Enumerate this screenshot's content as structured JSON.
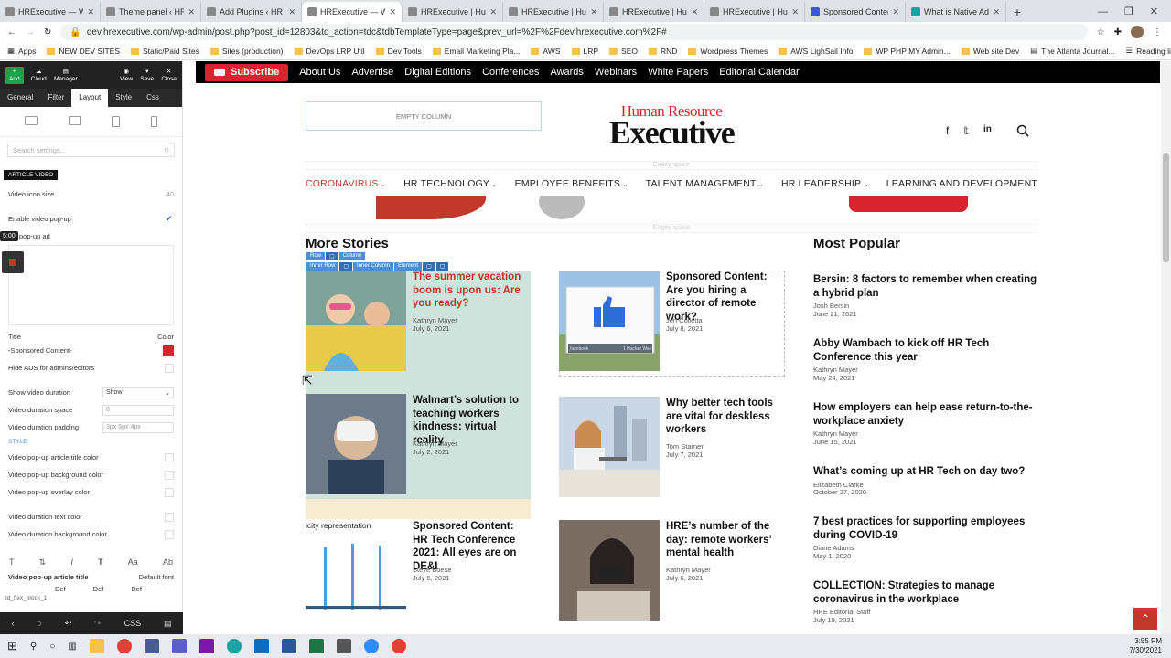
{
  "browser": {
    "tabs": [
      {
        "label": "HRExecutive — W",
        "active": false
      },
      {
        "label": "Theme panel ‹ HR",
        "active": false
      },
      {
        "label": "Add Plugins ‹ HR",
        "active": false
      },
      {
        "label": "HRExecutive — W",
        "active": true
      },
      {
        "label": "HRExecutive | Hum",
        "active": false
      },
      {
        "label": "HRExecutive | Hum",
        "active": false
      },
      {
        "label": "HRExecutive | Hum",
        "active": false
      },
      {
        "label": "HRExecutive | Hum",
        "active": false
      },
      {
        "label": "Sponsored Conten",
        "active": false
      },
      {
        "label": "What is Native Ad",
        "active": false
      }
    ],
    "url": "dev.hrexecutive.com/wp-admin/post.php?post_id=12803&td_action=tdc&tdbTemplateType=page&prev_url=%2F%2Fdev.hrexecutive.com%2F#",
    "bookmarks": [
      "Apps",
      "NEW DEV SITES",
      "Static/Paid Sites",
      "Sites (production)",
      "DevOps LRP Util",
      "Dev Tools",
      "Email Marketing Pla...",
      "AWS",
      "LRP",
      "SEO",
      "RND",
      "Wordpress Themes",
      "AWS LighSail Info",
      "WP PHP MY Admin...",
      "Web site Dev",
      "The Atlanta Journal...",
      "Reading list"
    ]
  },
  "editor": {
    "toolbar": [
      "Add",
      "Cloud",
      "Manager",
      "View",
      "Save",
      "Close"
    ],
    "tabs": [
      "General",
      "Filter",
      "Layout",
      "Style",
      "Css"
    ],
    "active_tab": "Layout",
    "search_placeholder": "Search settings...",
    "section": "ARTICLE VIDEO",
    "video_icon_size_label": "Video icon size",
    "video_icon_size_value": "40",
    "enable_popup_label": "Enable video pop-up",
    "popup_ad_label": "pop-up ad",
    "time_badge": "5:00",
    "title_label": "Title",
    "color_label": "Color",
    "title_value": "-Sponsored Content-",
    "hide_ads_label": "Hide ADS for admins/editors",
    "show_duration_label": "Show video duration",
    "show_duration_value": "Show",
    "duration_space_label": "Video duration space",
    "duration_space_value": "0",
    "duration_padding_label": "Video duration padding",
    "duration_padding_value": "3px 6px 4px",
    "style_header": "STYLE",
    "style_rows": [
      "Video pop-up article title color",
      "Video pop-up background color",
      "Video pop-up overlay color",
      "Video duration text color",
      "Video duration background color"
    ],
    "font_row_label": "Video pop-up article title",
    "font_row_value": "Default font",
    "def_values": [
      "Def",
      "Def",
      "Def"
    ],
    "flex_block_label": "td_flex_block_1",
    "bottom_css": "CSS"
  },
  "site": {
    "subscribe": "Subscribe",
    "top_links": [
      "About Us",
      "Advertise",
      "Digital Editions",
      "Conferences",
      "Awards",
      "Webinars",
      "White Papers",
      "Editorial Calendar"
    ],
    "empty_column": "EMPTY COLUMN",
    "logo_line1": "Human Resource",
    "logo_line2": "Executive",
    "empty_space": "Empty space",
    "nav": [
      "CORONAVIRUS",
      "HR TECHNOLOGY",
      "EMPLOYEE BENEFITS",
      "TALENT MANAGEMENT",
      "HR LEADERSHIP",
      "LEARNING AND DEVELOPMENT"
    ],
    "more_stories": "More Stories",
    "most_popular": "Most Popular",
    "tags_row1": [
      "Row",
      "Column"
    ],
    "tags_row2": [
      "Inner Row",
      "Inner Column",
      "Element"
    ],
    "stories": [
      {
        "title": "The summer vacation boom is upon us: Are you ready?",
        "author": "Kathryn Mayer",
        "date": "July 6, 2021"
      },
      {
        "title": "Sponsored Content: Are you hiring a director of remote work?",
        "author": "Jen Colletta",
        "date": "July 8, 2021"
      },
      {
        "title": "Walmart’s solution to teaching workers kindness: virtual reality",
        "author": "Kathryn Mayer",
        "date": "July 2, 2021"
      },
      {
        "title": "Why better tech tools are vital for deskless workers",
        "author": "Tom Starner",
        "date": "July 7, 2021"
      },
      {
        "title": "Sponsored Content: HR Tech Conference 2021: All eyes are on DE&I",
        "author": "Steve Boese",
        "date": "July 6, 2021"
      },
      {
        "title": "HRE’s number of the day: remote workers’ mental health",
        "author": "Kathryn Mayer",
        "date": "July 6, 2021"
      }
    ],
    "thumb_texts": {
      "facebook_sign": "1 Hacker Way",
      "facebook_word": "facebook",
      "chart_caption": "icity representation"
    },
    "popular": [
      {
        "title": "Bersin: 8 factors to remember when creating a hybrid plan",
        "author": "Josh Bersin",
        "date": "June 21, 2021"
      },
      {
        "title": "Abby Wambach to kick off HR Tech Conference this year",
        "author": "Kathryn Mayer",
        "date": "May 24, 2021"
      },
      {
        "title": "How employers can help ease return-to-the-workplace anxiety",
        "author": "Kathryn Mayer",
        "date": "June 15, 2021"
      },
      {
        "title": "What’s coming up at HR Tech on day two?",
        "author": "Elizabeth Clarke",
        "date": "October 27, 2020"
      },
      {
        "title": "7 best practices for supporting employees during COVID-19",
        "author": "Diane Adams",
        "date": "May 1, 2020"
      },
      {
        "title": "COLLECTION: Strategies to manage coronavirus in the workplace",
        "author": "HRE Editorial Staff",
        "date": "July 19, 2021"
      }
    ]
  },
  "taskbar": {
    "time": "3:55 PM",
    "date": "7/30/2021"
  },
  "colors": {
    "brand_red": "#d9232e",
    "accent_blue": "#4a90d9"
  }
}
